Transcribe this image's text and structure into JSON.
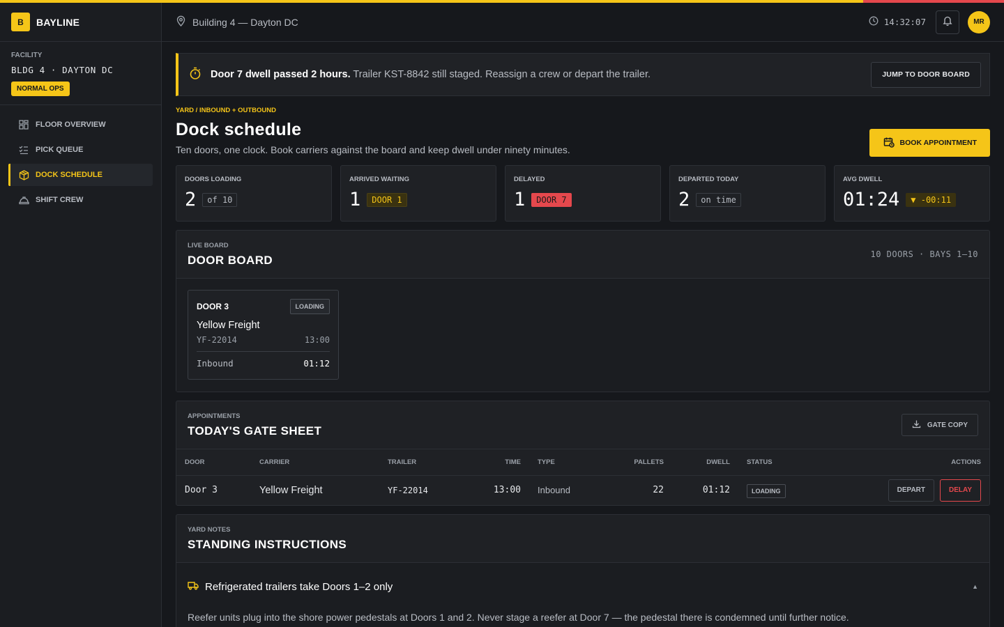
{
  "brand": {
    "mark": "B",
    "name": "BAYLINE"
  },
  "facility": {
    "label": "FACILITY",
    "name": "BLDG 4 · DAYTON DC",
    "status": "NORMAL OPS"
  },
  "nav": [
    {
      "label": "FLOOR OVERVIEW",
      "icon": "grid-icon"
    },
    {
      "label": "PICK QUEUE",
      "icon": "checklist-icon"
    },
    {
      "label": "DOCK SCHEDULE",
      "icon": "box-icon"
    },
    {
      "label": "SHIFT CREW",
      "icon": "hardhat-icon"
    }
  ],
  "topbar": {
    "location": "Building 4 — Dayton DC",
    "time": "14:32:07",
    "avatar": "MR"
  },
  "alert": {
    "strong": "Door 7 dwell passed 2 hours.",
    "text": "Trailer KST-8842 still staged. Reassign a crew or depart the trailer.",
    "action": "JUMP TO DOOR BOARD"
  },
  "page": {
    "eyebrow": "YARD / INBOUND + OUTBOUND",
    "title": "Dock schedule",
    "subtitle": "Ten doors, one clock. Book carriers against the board and keep dwell under ninety minutes.",
    "primary_action": "BOOK APPOINTMENT"
  },
  "stats": [
    {
      "label": "DOORS LOADING",
      "value": "2",
      "chip": "of 10"
    },
    {
      "label": "ARRIVED WAITING",
      "value": "1",
      "chip": "DOOR 1"
    },
    {
      "label": "DELAYED",
      "value": "1",
      "chip": "DOOR 7"
    },
    {
      "label": "DEPARTED TODAY",
      "value": "2",
      "chip": "on time"
    },
    {
      "label": "AVG DWELL",
      "value": "01:24",
      "chip": "▼ -00:11"
    }
  ],
  "board": {
    "eyebrow": "LIVE BOARD",
    "title": "DOOR BOARD",
    "meta": "10 DOORS · BAYS 1–10",
    "door": {
      "name": "DOOR 3",
      "status": "LOADING",
      "carrier": "Yellow Freight",
      "trailer": "YF-22014",
      "time": "13:00",
      "type": "Inbound",
      "dwell": "01:12"
    }
  },
  "gate": {
    "eyebrow": "APPOINTMENTS",
    "title": "TODAY'S GATE SHEET",
    "copy_label": "GATE COPY",
    "columns": [
      "DOOR",
      "CARRIER",
      "TRAILER",
      "TIME",
      "TYPE",
      "PALLETS",
      "DWELL",
      "STATUS",
      "ACTIONS"
    ],
    "rows": [
      {
        "door": "Door 3",
        "carrier": "Yellow Freight",
        "trailer": "YF-22014",
        "time": "13:00",
        "type": "Inbound",
        "pallets": "22",
        "dwell": "01:12",
        "status": "LOADING",
        "depart": "DEPART",
        "delay": "DELAY"
      }
    ]
  },
  "notes": {
    "eyebrow": "YARD NOTES",
    "title": "STANDING INSTRUCTIONS",
    "item_title": "Refrigerated trailers take Doors 1–2 only",
    "item_text": "Reefer units plug into the shore power pedestals at Doors 1 and 2. Never stage a reefer at Door 7 — the pedestal there is condemned until further notice."
  },
  "colors": {
    "accent": "#f5c518",
    "danger": "#e5484d",
    "background": "#16181c"
  }
}
